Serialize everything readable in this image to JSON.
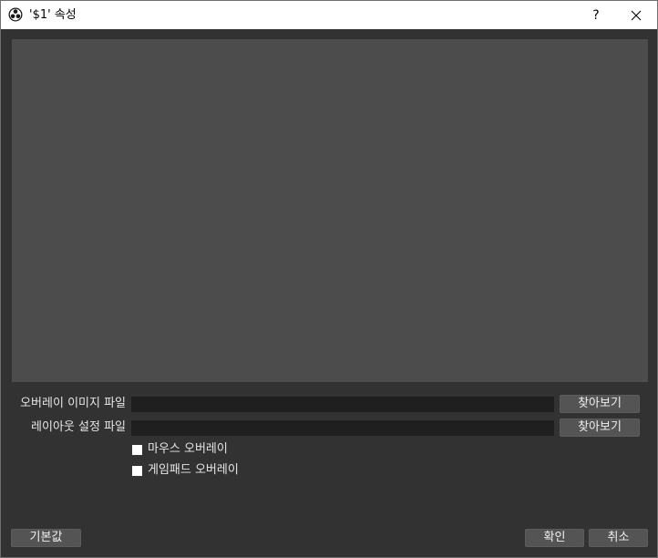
{
  "window": {
    "title": "'$1' 속성",
    "help_label": "?",
    "close_icon": "close-icon"
  },
  "form": {
    "overlay_image": {
      "label": "오버레이 이미지 파일",
      "value": "",
      "browse_label": "찾아보기"
    },
    "layout_settings": {
      "label": "레이아웃 설정 파일",
      "value": "",
      "browse_label": "찾아보기"
    },
    "checkboxes": [
      {
        "label": "마우스 오버레이",
        "checked": false
      },
      {
        "label": "게임패드 오버레이",
        "checked": false
      }
    ]
  },
  "footer": {
    "defaults_label": "기본값",
    "ok_label": "확인",
    "cancel_label": "취소"
  },
  "colors": {
    "background": "#323232",
    "preview": "#4c4c4c",
    "input": "#1f1f1f",
    "button": "#545454"
  }
}
